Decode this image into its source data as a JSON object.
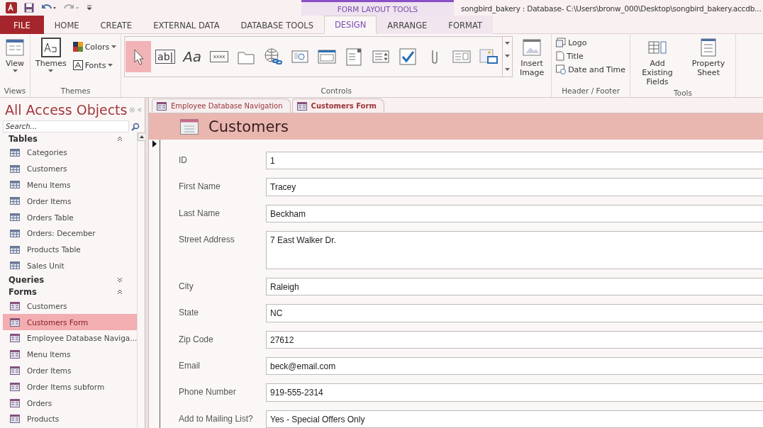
{
  "title_bar": {
    "contextual_header": "FORM LAYOUT TOOLS",
    "title": "songbird_bakery : Database- C:\\Users\\bronw_000\\Desktop\\songbird_bakery.accdb..."
  },
  "ribbon_tabs": [
    {
      "label": "FILE",
      "kind": "file",
      "selected": false
    },
    {
      "label": "HOME",
      "kind": "normal",
      "selected": false
    },
    {
      "label": "CREATE",
      "kind": "normal",
      "selected": false
    },
    {
      "label": "EXTERNAL DATA",
      "kind": "normal",
      "selected": false
    },
    {
      "label": "DATABASE TOOLS",
      "kind": "normal",
      "selected": false
    },
    {
      "label": "DESIGN",
      "kind": "contextual",
      "selected": true
    },
    {
      "label": "ARRANGE",
      "kind": "contextual",
      "selected": false
    },
    {
      "label": "FORMAT",
      "kind": "contextual",
      "selected": false
    }
  ],
  "ribbon": {
    "views": {
      "label": "Views",
      "view_button": "View"
    },
    "themes": {
      "label": "Themes",
      "themes_button": "Themes",
      "colors_button": "Colors",
      "fonts_button": "Fonts"
    },
    "controls": {
      "label": "Controls",
      "gallery": [
        {
          "kind": "pointer",
          "selected": true
        },
        {
          "kind": "textbox",
          "glyph": "ab|",
          "selected": false
        },
        {
          "kind": "label",
          "glyph": "Aa",
          "selected": false
        },
        {
          "kind": "button",
          "glyph": "xxxx",
          "selected": false
        },
        {
          "kind": "tab",
          "selected": false
        },
        {
          "kind": "hyperlink",
          "selected": false
        },
        {
          "kind": "web",
          "selected": false
        },
        {
          "kind": "navigation",
          "selected": false
        },
        {
          "kind": "combo",
          "selected": false
        },
        {
          "kind": "list",
          "selected": false
        },
        {
          "kind": "checkbox",
          "selected": false
        },
        {
          "kind": "attachment",
          "selected": false
        },
        {
          "kind": "option-group",
          "selected": false
        },
        {
          "kind": "image",
          "selected": false
        }
      ],
      "insert_image": "Insert Image"
    },
    "header_footer": {
      "label": "Header / Footer",
      "items": [
        {
          "kind": "logo",
          "label": "Logo"
        },
        {
          "kind": "title",
          "label": "Title"
        },
        {
          "kind": "date",
          "label": "Date and Time"
        }
      ]
    },
    "tools": {
      "label": "Tools",
      "items": [
        {
          "kind": "fields",
          "label": "Add Existing Fields"
        },
        {
          "kind": "sheet",
          "label": "Property Sheet"
        }
      ]
    }
  },
  "nav_pane": {
    "title": "All Access Objects",
    "search_placeholder": "Search...",
    "groups": [
      {
        "label": "Tables",
        "kind": "table",
        "expanded": true,
        "items": [
          {
            "label": "Categories",
            "selected": false
          },
          {
            "label": "Customers",
            "selected": false
          },
          {
            "label": "Menu Items",
            "selected": false
          },
          {
            "label": "Order Items",
            "selected": false
          },
          {
            "label": "Orders Table",
            "selected": false
          },
          {
            "label": "Orders: December",
            "selected": false
          },
          {
            "label": "Products Table",
            "selected": false
          },
          {
            "label": "Sales Unit",
            "selected": false
          }
        ]
      },
      {
        "label": "Queries",
        "kind": "query",
        "expanded": false
      },
      {
        "label": "Forms",
        "kind": "form",
        "expanded": true,
        "items": [
          {
            "label": "Customers",
            "selected": false
          },
          {
            "label": "Customers Form",
            "selected": true
          },
          {
            "label": "Employee Database Naviga...",
            "selected": false
          },
          {
            "label": "Menu Items",
            "selected": false
          },
          {
            "label": "Order Items",
            "selected": false
          },
          {
            "label": "Order Items  subform",
            "selected": false
          },
          {
            "label": "Orders",
            "selected": false
          },
          {
            "label": "Products",
            "selected": false
          }
        ]
      }
    ]
  },
  "document_tabs": [
    {
      "label": "Employee Database Navigation",
      "selected": false
    },
    {
      "label": "Customers Form",
      "selected": true
    }
  ],
  "form": {
    "title": "Customers",
    "fields": [
      {
        "label": "ID",
        "value": "1",
        "kind": "single"
      },
      {
        "label": "First Name",
        "value": "Tracey",
        "kind": "single"
      },
      {
        "label": "Last Name",
        "value": "Beckham",
        "kind": "single"
      },
      {
        "label": "Street Address",
        "value": "7 East Walker Dr.",
        "kind": "multiline"
      },
      {
        "label": "City",
        "value": "Raleigh",
        "kind": "single"
      },
      {
        "label": "State",
        "value": "NC",
        "kind": "single"
      },
      {
        "label": "Zip Code",
        "value": "27612",
        "kind": "single"
      },
      {
        "label": "Email",
        "value": "beck@email.com",
        "kind": "single"
      },
      {
        "label": "Phone Number",
        "value": "919-555-2314",
        "kind": "single"
      },
      {
        "label": "Add to Mailing List?",
        "value": "Yes - Special Offers Only",
        "kind": "single"
      }
    ]
  }
}
